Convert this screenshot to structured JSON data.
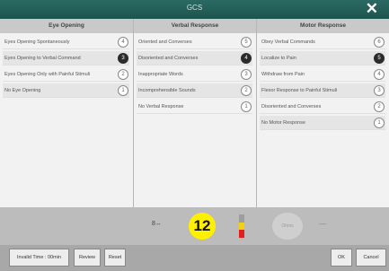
{
  "window": {
    "title": "GCS",
    "close_symbol": "✕"
  },
  "columns": [
    {
      "header": "Eye Opening",
      "options": [
        {
          "label": "Eyes Opening Spontaneously",
          "score": "4",
          "selected": false
        },
        {
          "label": "Eyes Opening to Verbal Command",
          "score": "3",
          "selected": true
        },
        {
          "label": "Eyes Opening Only with Painful Stimuli",
          "score": "2",
          "selected": false
        },
        {
          "label": "No Eye Opening",
          "score": "1",
          "selected": false
        }
      ]
    },
    {
      "header": "Verbal Response",
      "options": [
        {
          "label": "Oriented and Converses",
          "score": "5",
          "selected": false
        },
        {
          "label": "Disoriented and Converses",
          "score": "4",
          "selected": true
        },
        {
          "label": "Inappropriate Words",
          "score": "3",
          "selected": false
        },
        {
          "label": "Incomprehensible Sounds",
          "score": "2",
          "selected": false
        },
        {
          "label": "No Verbal Response",
          "score": "1",
          "selected": false
        }
      ]
    },
    {
      "header": "Motor Response",
      "options": [
        {
          "label": "Obey Verbal Commands",
          "score": "6",
          "selected": false
        },
        {
          "label": "Localize to Pain",
          "score": "5",
          "selected": true
        },
        {
          "label": "Withdraw from Pain",
          "score": "4",
          "selected": false
        },
        {
          "label": "Flexor Response to Painful Stimuli",
          "score": "3",
          "selected": false
        },
        {
          "label": "Disoriented and Converses",
          "score": "2",
          "selected": false
        },
        {
          "label": "No Motor Response",
          "score": "1",
          "selected": false
        }
      ]
    }
  ],
  "summary": {
    "small_icon": "8↔",
    "total": "12",
    "flag_colors": [
      "#9e9e9e",
      "#f2d10f",
      "#e02020"
    ],
    "faded_label": "Ohms",
    "dash": "—"
  },
  "buttons": {
    "invalid": "Invalid Time : 00min",
    "review": "Review",
    "reset": "Reset",
    "ok": "OK",
    "cancel": "Cancel"
  }
}
